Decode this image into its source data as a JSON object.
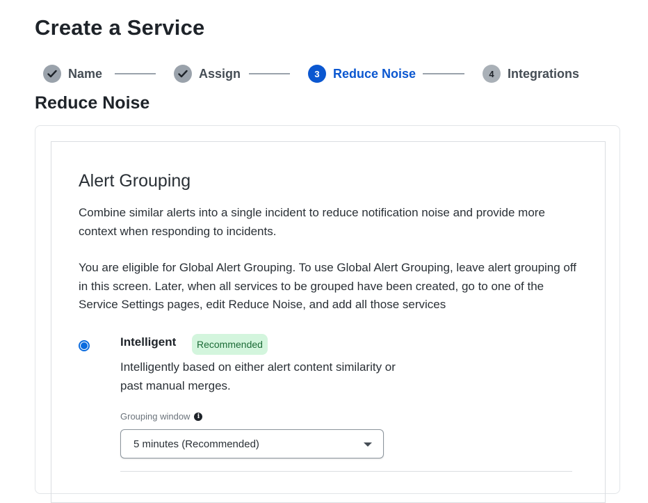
{
  "page": {
    "title": "Create a Service"
  },
  "stepper": {
    "steps": [
      {
        "number": "✓",
        "label": "Name",
        "state": "done"
      },
      {
        "number": "✓",
        "label": "Assign",
        "state": "done"
      },
      {
        "number": "3",
        "label": "Reduce Noise",
        "state": "active"
      },
      {
        "number": "4",
        "label": "Integrations",
        "state": "todo"
      }
    ]
  },
  "section": {
    "title": "Reduce Noise"
  },
  "alert_grouping": {
    "title": "Alert Grouping",
    "description": "Combine similar alerts into a single incident to reduce notification noise and provide more context when responding to incidents.",
    "eligibility": "You are eligible for Global Alert Grouping. To use Global Alert Grouping, leave alert grouping off in this screen. Later, when all services to be grouped have been created, go to one of the Service Settings pages, edit Reduce Noise, and add all those services",
    "option": {
      "title": "Intelligent",
      "badge": "Recommended",
      "selected": true,
      "description": "Intelligently based on either alert content similarity or past manual merges."
    },
    "grouping_window": {
      "label": "Grouping window",
      "value": "5 minutes (Recommended)"
    }
  },
  "colors": {
    "accent": "#0b57d0",
    "badge_bg": "#d3f5dd",
    "badge_text": "#1b6b36",
    "step_done": "#9aa2ab"
  },
  "icons": {
    "step_done": "check-icon",
    "info": "info-icon",
    "select": "caret-down-icon"
  }
}
